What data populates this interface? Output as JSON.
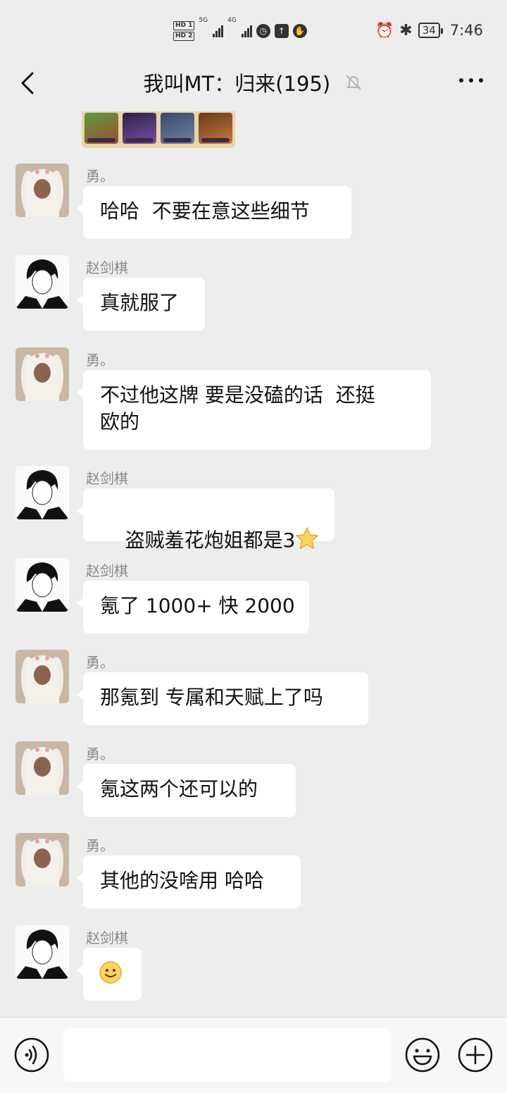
{
  "status_bar": {
    "hd1": "HD 1",
    "hd2": "HD 2",
    "network1": "5G",
    "network2": "4G",
    "battery": "34",
    "time": "7:46",
    "icons": [
      "alarm-icon",
      "bluetooth-icon"
    ]
  },
  "header": {
    "title": "我叫MT：归来(195)",
    "icons": [
      "back-arrow-icon",
      "mute-bell-icon",
      "more-dots-icon"
    ]
  },
  "messages": [
    {
      "sender": "勇。",
      "text": "哈哈  不要在意这些细节",
      "avatar": "bunny-hat-avatar"
    },
    {
      "sender": "赵剑棋",
      "text": "真就服了",
      "avatar": "anime-boy-avatar"
    },
    {
      "sender": "勇。",
      "text_lines": [
        "不过他这牌 要是没磕的话  还挺",
        "欧的"
      ],
      "avatar": "bunny-hat-avatar"
    },
    {
      "sender": "赵剑棋",
      "text": "盗贼羞花炮姐都是3",
      "emoji": "star-emoji",
      "avatar": "anime-boy-avatar"
    },
    {
      "sender": "赵剑棋",
      "text": "氪了 1000+ 快 2000",
      "avatar": "anime-boy-avatar"
    },
    {
      "sender": "勇。",
      "text": "那氪到 专属和天赋上了吗",
      "avatar": "bunny-hat-avatar"
    },
    {
      "sender": "勇。",
      "text": "氪这两个还可以的",
      "avatar": "bunny-hat-avatar"
    },
    {
      "sender": "勇。",
      "text": "其他的没啥用 哈哈",
      "avatar": "bunny-hat-avatar"
    },
    {
      "sender": "赵剑棋",
      "emoji": "smile-emoji",
      "avatar": "anime-boy-avatar"
    }
  ],
  "input_bar": {
    "icons": [
      "voice-icon",
      "emoji-face-icon",
      "plus-icon"
    ]
  },
  "colors": {
    "background": "#ededed",
    "bubble": "#ffffff",
    "sender_name": "#8a8a8a"
  }
}
